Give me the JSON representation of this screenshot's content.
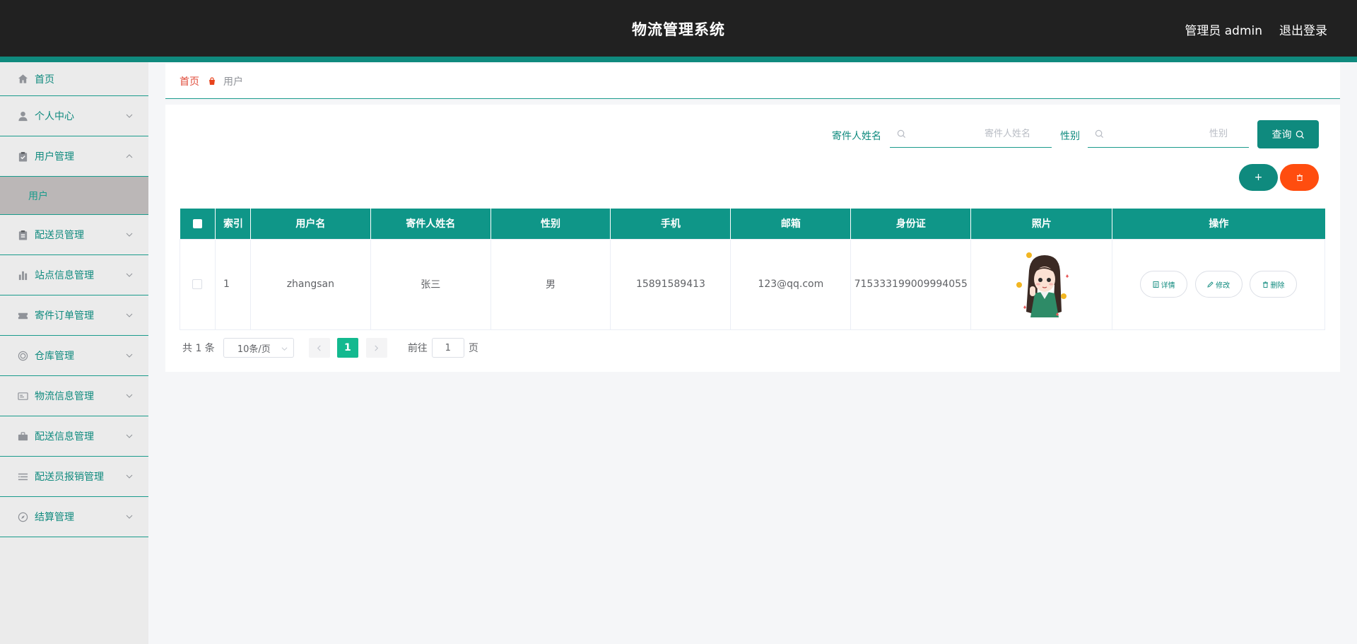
{
  "header": {
    "title": "物流管理系统",
    "admin_label": "管理员 admin",
    "logout_label": "退出登录"
  },
  "sidebar": {
    "items": [
      {
        "label": "首页",
        "icon": "home-icon"
      },
      {
        "label": "个人中心",
        "icon": "user-icon"
      },
      {
        "label": "用户管理",
        "icon": "clipboard-icon",
        "expanded": true,
        "children": [
          {
            "label": "用户"
          }
        ]
      },
      {
        "label": "配送员管理",
        "icon": "clipboard-icon"
      },
      {
        "label": "站点信息管理",
        "icon": "bar-chart-icon"
      },
      {
        "label": "寄件订单管理",
        "icon": "ticket-icon"
      },
      {
        "label": "仓库管理",
        "icon": "circle-target-icon"
      },
      {
        "label": "物流信息管理",
        "icon": "id-card-icon"
      },
      {
        "label": "配送信息管理",
        "icon": "briefcase-icon"
      },
      {
        "label": "配送员报销管理",
        "icon": "list-icon"
      },
      {
        "label": "结算管理",
        "icon": "compass-icon"
      }
    ]
  },
  "breadcrumb": {
    "home": "首页",
    "current": "用户"
  },
  "search": {
    "sender_label": "寄件人姓名",
    "sender_placeholder": "寄件人姓名",
    "gender_label": "性别",
    "gender_placeholder": "性别",
    "query_label": "查询",
    "add_label": "+"
  },
  "table": {
    "columns": [
      "索引",
      "用户名",
      "寄件人姓名",
      "性别",
      "手机",
      "邮箱",
      "身份证",
      "照片",
      "操作"
    ],
    "rows": [
      {
        "index": "1",
        "username": "zhangsan",
        "sender_name": "张三",
        "gender": "男",
        "phone": "15891589413",
        "email": "123@qq.com",
        "id_card": "715333199009994055"
      }
    ],
    "actions": {
      "detail": "详情",
      "edit": "修改",
      "delete": "删除"
    }
  },
  "pagination": {
    "total": "共 1 条",
    "page_size": "10条/页",
    "current_page": "1",
    "goto_prefix": "前往",
    "goto_value": "1",
    "goto_suffix": "页"
  },
  "colors": {
    "accent": "#0f8a7e",
    "header_bg": "#212121",
    "danger": "#ff4d0f",
    "pager_active": "#13b98f"
  }
}
